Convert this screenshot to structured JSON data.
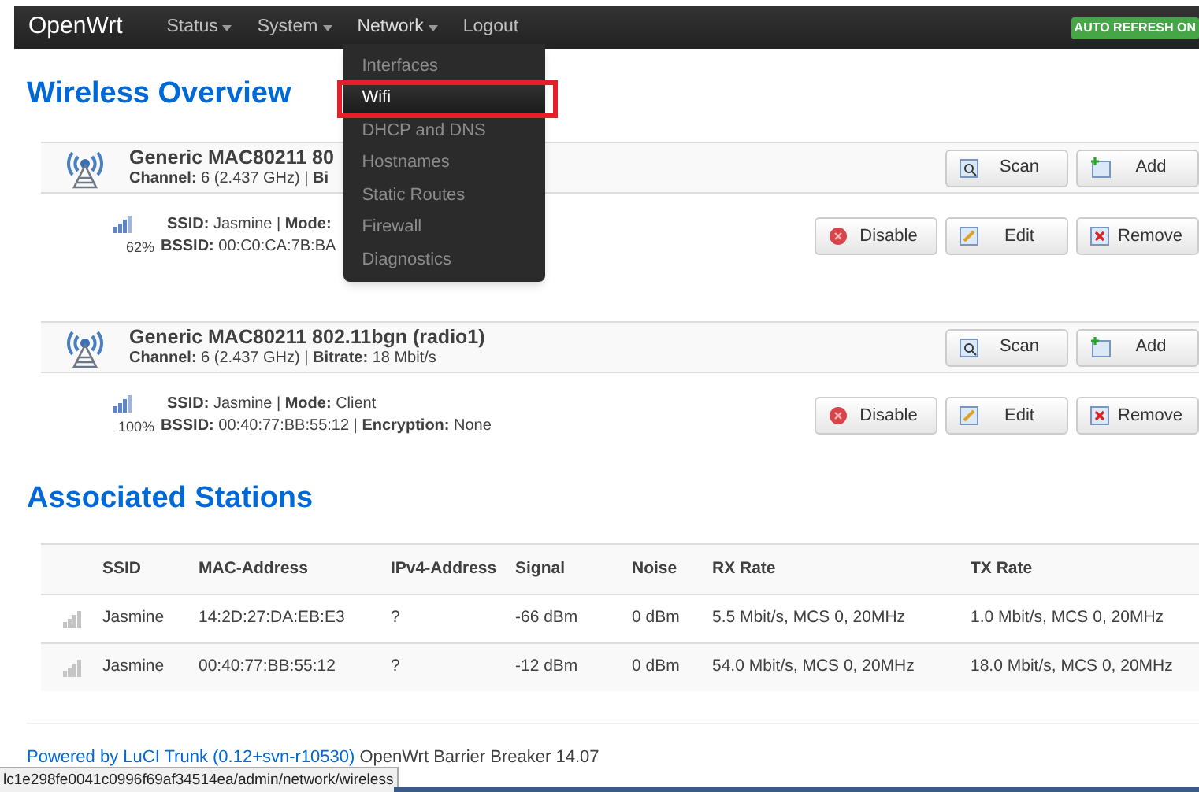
{
  "navbar": {
    "brand": "OpenWrt",
    "menus": [
      {
        "label": "Status",
        "caret": true,
        "open": false
      },
      {
        "label": "System",
        "caret": true,
        "open": false
      },
      {
        "label": "Network",
        "caret": true,
        "open": true
      },
      {
        "label": "Logout",
        "caret": false,
        "open": false
      }
    ],
    "badge": "AUTO REFRESH ON"
  },
  "dropdown": {
    "items": [
      {
        "label": "Interfaces",
        "selected": false
      },
      {
        "label": "Wifi",
        "selected": true
      },
      {
        "label": "DHCP and DNS",
        "selected": false
      },
      {
        "label": "Hostnames",
        "selected": false
      },
      {
        "label": "Static Routes",
        "selected": false
      },
      {
        "label": "Firewall",
        "selected": false
      },
      {
        "label": "Diagnostics",
        "selected": false
      }
    ]
  },
  "wireless_overview": {
    "title": "Wireless Overview",
    "radios": [
      {
        "name": "Generic MAC80211 80",
        "info": "**Channel:** 6 (2.437 GHz) | **Bi**",
        "buttons": [
          {
            "kind": "scan",
            "label": "Scan"
          },
          {
            "kind": "add",
            "label": "Add"
          }
        ],
        "networks": [
          {
            "signal": "62%",
            "line1": "**SSID:** Jasmine | **Mode:**",
            "line2": "**BSSID:** 00:C0:CA:7B:BA",
            "buttons": [
              {
                "kind": "disable",
                "label": "Disable"
              },
              {
                "kind": "edit",
                "label": "Edit"
              },
              {
                "kind": "remove",
                "label": "Remove"
              }
            ]
          }
        ]
      },
      {
        "name": "Generic MAC80211 802.11bgn (radio1)",
        "info": "**Channel:** 6 (2.437 GHz) | **Bitrate:** 18 Mbit/s",
        "buttons": [
          {
            "kind": "scan",
            "label": "Scan"
          },
          {
            "kind": "add",
            "label": "Add"
          }
        ],
        "networks": [
          {
            "signal": "100%",
            "line1": "**SSID:** Jasmine | **Mode:** Client",
            "line2": "**BSSID:** 00:40:77:BB:55:12 | **Encryption:** None",
            "buttons": [
              {
                "kind": "disable",
                "label": "Disable"
              },
              {
                "kind": "edit",
                "label": "Edit"
              },
              {
                "kind": "remove",
                "label": "Remove"
              }
            ]
          }
        ]
      }
    ]
  },
  "associated_stations": {
    "title": "Associated Stations",
    "table": {
      "columns": [
        "SSID",
        "MAC-Address",
        "IPv4-Address",
        "Signal",
        "Noise",
        "RX Rate",
        "TX Rate"
      ],
      "rows": [
        [
          "Jasmine",
          "14:2D:27:DA:EB:E3",
          "?",
          "-66 dBm",
          "0 dBm",
          "5.5 Mbit/s, MCS 0, 20MHz",
          "1.0 Mbit/s, MCS 0, 20MHz"
        ],
        [
          "Jasmine",
          "00:40:77:BB:55:12",
          "?",
          "-12 dBm",
          "0 dBm",
          "54.0 Mbit/s, MCS 0, 20MHz",
          "18.0 Mbit/s, MCS 0, 20MHz"
        ]
      ]
    }
  },
  "footer": {
    "link": "Powered by LuCI Trunk (0.12+svn-r10530)",
    "text": "OpenWrt Barrier Breaker 14.07"
  },
  "status_url": "lc1e298fe0041c0996f69af34514ea/admin/network/wireless"
}
